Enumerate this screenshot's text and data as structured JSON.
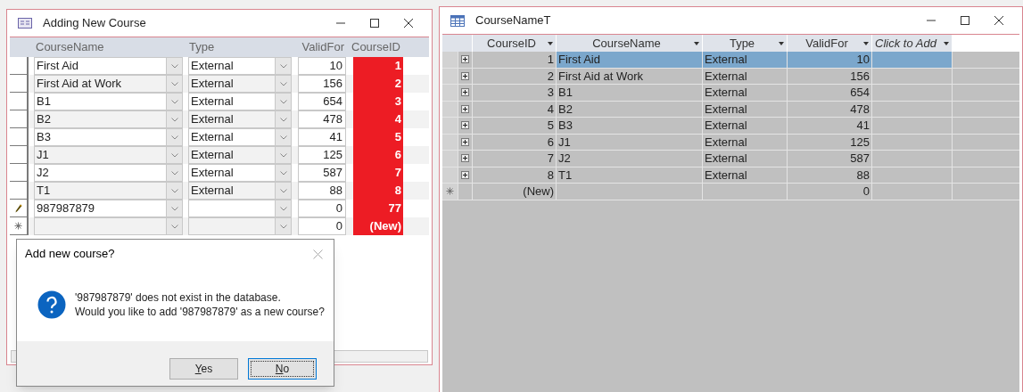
{
  "form_window": {
    "title": "Adding New Course",
    "columns": [
      "CourseName",
      "Type",
      "ValidFor",
      "CourseID"
    ],
    "rows": [
      {
        "kind": "plain",
        "course_name": "First Aid",
        "type": "External",
        "valid_for": "10",
        "course_id": "1"
      },
      {
        "kind": "plain",
        "course_name": "First Aid at Work",
        "type": "External",
        "valid_for": "156",
        "course_id": "2"
      },
      {
        "kind": "plain",
        "course_name": "B1",
        "type": "External",
        "valid_for": "654",
        "course_id": "3"
      },
      {
        "kind": "plain",
        "course_name": "B2",
        "type": "External",
        "valid_for": "478",
        "course_id": "4"
      },
      {
        "kind": "plain",
        "course_name": "B3",
        "type": "External",
        "valid_for": "41",
        "course_id": "5"
      },
      {
        "kind": "plain",
        "course_name": "J1",
        "type": "External",
        "valid_for": "125",
        "course_id": "6"
      },
      {
        "kind": "plain",
        "course_name": "J2",
        "type": "External",
        "valid_for": "587",
        "course_id": "7"
      },
      {
        "kind": "plain",
        "course_name": "T1",
        "type": "External",
        "valid_for": "88",
        "course_id": "8"
      },
      {
        "kind": "editing",
        "course_name": "987987879",
        "valid_for": "0",
        "course_id": "77"
      },
      {
        "kind": "new",
        "valid_for": "0",
        "course_id": "(New)"
      }
    ]
  },
  "table_window": {
    "title": "CourseNameT",
    "columns": [
      "CourseID",
      "CourseName",
      "Type",
      "ValidFor",
      "Click to Add"
    ],
    "rows": [
      {
        "kind": "record",
        "selected": true,
        "course_id": "1",
        "course_name": "First Aid",
        "type": "External",
        "valid_for": "10"
      },
      {
        "kind": "record",
        "selected": false,
        "course_id": "2",
        "course_name": "First Aid at Work",
        "type": "External",
        "valid_for": "156"
      },
      {
        "kind": "record",
        "selected": false,
        "course_id": "3",
        "course_name": "B1",
        "type": "External",
        "valid_for": "654"
      },
      {
        "kind": "record",
        "selected": false,
        "course_id": "4",
        "course_name": "B2",
        "type": "External",
        "valid_for": "478"
      },
      {
        "kind": "record",
        "selected": false,
        "course_id": "5",
        "course_name": "B3",
        "type": "External",
        "valid_for": "41"
      },
      {
        "kind": "record",
        "selected": false,
        "course_id": "6",
        "course_name": "J1",
        "type": "External",
        "valid_for": "125"
      },
      {
        "kind": "record",
        "selected": false,
        "course_id": "7",
        "course_name": "J2",
        "type": "External",
        "valid_for": "587"
      },
      {
        "kind": "record",
        "selected": false,
        "course_id": "8",
        "course_name": "T1",
        "type": "External",
        "valid_for": "88"
      },
      {
        "kind": "new",
        "selected": false,
        "course_id": "(New)",
        "valid_for": "0"
      }
    ]
  },
  "dialog": {
    "title": "Add new course?",
    "message": [
      "'987987879' does not exist in the database.",
      "Would you like to add '987987879' as a new course?"
    ],
    "buttons": [
      {
        "label": "Yes",
        "focused": false
      },
      {
        "label": "No",
        "focused": true
      }
    ]
  }
}
